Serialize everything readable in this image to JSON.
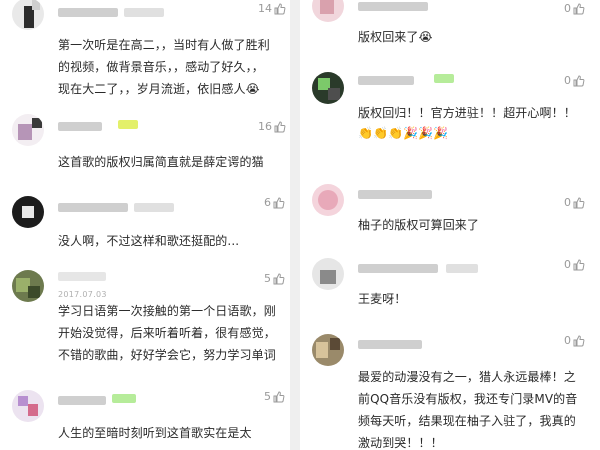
{
  "left_comments": [
    {
      "likes": "14",
      "text": "第一次听是在高二，，当时有人做了胜利\n的视频，做背景音乐，，感动了好久，，\n现在大二了，，岁月流逝，依旧感人",
      "emoji": "😭"
    },
    {
      "likes": "16",
      "text": "这首歌的版权归属简直就是薛定谔的猫"
    },
    {
      "likes": "6",
      "text": "没人啊，不过这样和歌还挺配的..."
    },
    {
      "likes": "5",
      "date": "2017.07.03",
      "text": "学习日语第一次接触的第一个日语歌，刚\n开始没觉得，后来听着听着，很有感觉，\n不错的歌曲，好好学会它，努力学习单词"
    },
    {
      "likes": "5",
      "text": "人生的至暗时刻听到这首歌实在是太"
    }
  ],
  "right_comments": [
    {
      "likes": "0",
      "text": "版权回来了",
      "emoji": "😭"
    },
    {
      "likes": "0",
      "text": "版权回归！！官方进驻！！超开心啊！！",
      "emoji_row": "👏👏👏🎉🎉🎉"
    },
    {
      "likes": "0",
      "text": "柚子的版权可算回来了"
    },
    {
      "likes": "0",
      "text": "王麦呀！"
    },
    {
      "likes": "0",
      "text": "最爱的动漫没有之一，猎人永远最棒！之\n前QQ音乐没有版权，我还专门录MV的音\n频每天听，结果现在柚子入驻了，我真的\n激动到哭！！！"
    }
  ],
  "icons": {
    "like": "thumbs-up-icon"
  },
  "colors": {
    "like": "#9a9a9a",
    "text": "#2a2a2a",
    "badge": "#b6ec9a"
  }
}
